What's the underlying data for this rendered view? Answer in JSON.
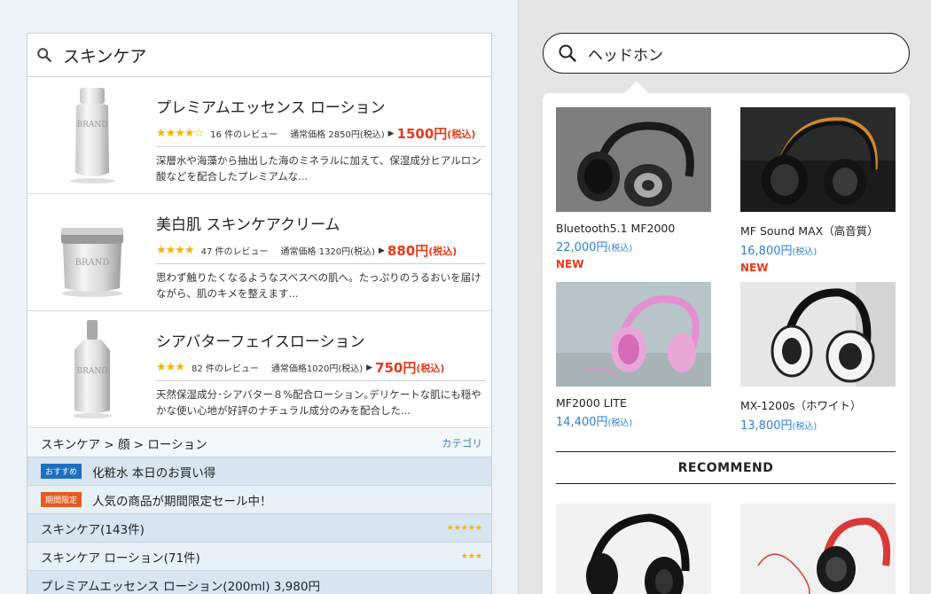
{
  "left": {
    "search": {
      "value": "スキンケア",
      "icon": "search-icon"
    },
    "products": [
      {
        "name": "プレミアムエッセンス ローション",
        "stars": "★★★★☆",
        "reviews": "16 件のレビュー",
        "regular_price": "通常価格 2850円(税込)",
        "sale_price": "1500円",
        "tax": "(税込)",
        "description": "深層水や海藻から抽出した海のミネラルに加えて、保湿成分ヒアルロン酸などを配合したプレミアムな...",
        "image_label": "BRAND"
      },
      {
        "name": "美白肌 スキンケアクリーム",
        "stars": "★★★★",
        "reviews": "47 件のレビュー",
        "regular_price": "通常価格 1320円(税込)",
        "sale_price": "880円",
        "tax": "(税込)",
        "description": "思わず触りたくなるようなスベスベの肌へ。たっぷりのうるおいを届けながら、肌のキメを整えます...",
        "image_label": "BRAND"
      },
      {
        "name": "シアバターフェイスローション",
        "stars": "★★★",
        "reviews": "82 件のレビュー",
        "regular_price": "通常価格1020円(税込)",
        "sale_price": "750円",
        "tax": "(税込)",
        "description": "天然保湿成分･シアバター８%配合ローション｡デリケートな肌にも穏やかな使い心地が好評のナチュラル成分のみを配合した...",
        "image_label": "BRAND"
      }
    ],
    "breadcrumb": {
      "path": "スキンケア > 顔 > ローション",
      "category_link": "カテゴリ"
    },
    "suggestions": [
      {
        "badge": "おすすめ",
        "text": "化粧水 本日のお買い得"
      },
      {
        "badge": "期間限定",
        "text": "人気の商品が期間限定セール中！"
      },
      {
        "text": "スキンケア(143件)",
        "stars": "★★★★★"
      },
      {
        "text": "スキンケア ローション(71件)",
        "stars": "★★★"
      },
      {
        "text": "プレミアムエッセンス ローション(200ml) 3,980円"
      }
    ]
  },
  "right": {
    "search": {
      "value": "ヘッドホン",
      "icon": "search-icon"
    },
    "items": [
      {
        "name": "Bluetooth5.1 MF2000",
        "price": "22,000円",
        "tax": "(税込)",
        "badge": "NEW"
      },
      {
        "name": "MF Sound MAX（高音質）",
        "price": "16,800円",
        "tax": "(税込)",
        "badge": "NEW"
      },
      {
        "name": "MF2000 LITE",
        "price": "14,400円",
        "tax": "(税込)"
      },
      {
        "name": "MX-1200s（ホワイト）",
        "price": "13,800円",
        "tax": "(税込)"
      }
    ],
    "recommend_title": "RECOMMEND",
    "colors": {
      "accent_blue": "#2d7fd0",
      "sale_red": "#e43a1a",
      "star_gold": "#f0b400"
    }
  }
}
